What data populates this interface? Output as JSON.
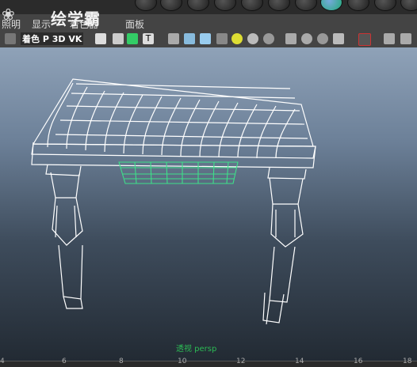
{
  "menu": {
    "items": [
      "照明",
      "显示",
      "着色器",
      "面板"
    ]
  },
  "watermark": {
    "brand": "绘学霸"
  },
  "toolbar": {
    "overlay": "着色 P 3D VK",
    "text_icon": "T"
  },
  "viewport": {
    "camera_label": "透视 persp"
  },
  "timeline": {
    "ticks": [
      "4",
      "6",
      "8",
      "10",
      "12",
      "14",
      "16",
      "18"
    ]
  },
  "colors": {
    "selection": "#3ee08a",
    "wireframe": "#ffffff",
    "bg_top": "#8fa2b8",
    "bg_bottom": "#222a33"
  }
}
